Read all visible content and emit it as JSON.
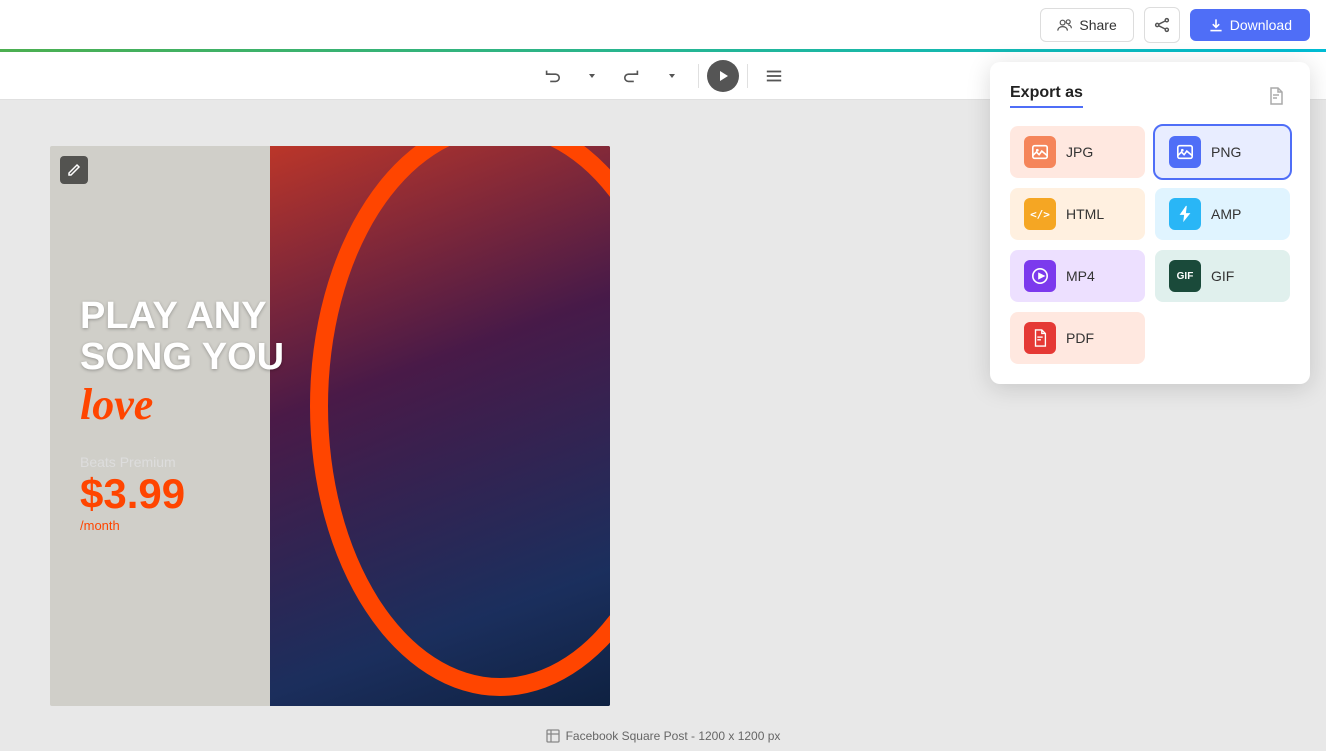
{
  "topbar": {
    "share_label": "Share",
    "download_label": "Download"
  },
  "toolbar": {
    "undo_label": "Undo",
    "redo_label": "Redo",
    "play_label": "Play",
    "menu_label": "Menu"
  },
  "canvas": {
    "headline1": "PLAY ANY",
    "headline2": "SONG YOU",
    "love": "love",
    "subtitle": "Beats Premium",
    "price": "$3.99",
    "period": "/month"
  },
  "status": {
    "label": "Facebook Square Post - 1200 x 1200 px"
  },
  "export_panel": {
    "title": "Export as",
    "options": [
      {
        "id": "jpg",
        "label": "JPG",
        "icon_class": "opt-jpg",
        "icon_symbol": "🖼"
      },
      {
        "id": "png",
        "label": "PNG",
        "icon_class": "opt-png",
        "icon_symbol": "🖼"
      },
      {
        "id": "html",
        "label": "HTML",
        "icon_class": "opt-html",
        "icon_symbol": "⟨/⟩"
      },
      {
        "id": "amp",
        "label": "AMP",
        "icon_class": "opt-amp",
        "icon_symbol": "⚡"
      },
      {
        "id": "mp4",
        "label": "MP4",
        "icon_class": "opt-mp4",
        "icon_symbol": "▶"
      },
      {
        "id": "gif",
        "label": "GIF",
        "icon_class": "opt-gif",
        "icon_symbol": "🎞"
      },
      {
        "id": "pdf",
        "label": "PDF",
        "icon_class": "opt-pdf",
        "icon_symbol": "📄"
      }
    ]
  }
}
